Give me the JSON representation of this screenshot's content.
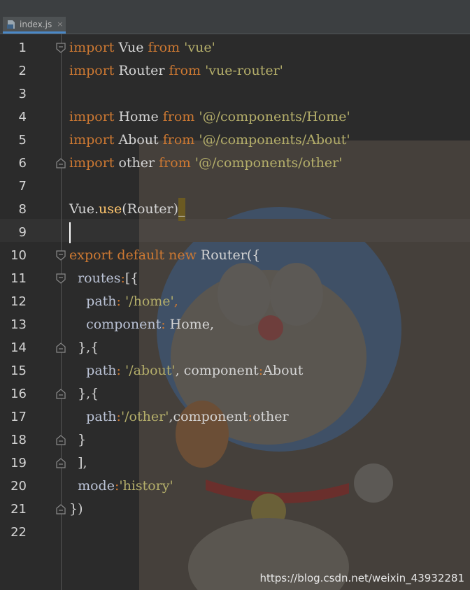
{
  "tab": {
    "label": "index.js",
    "close": "×"
  },
  "lines": [
    {
      "num": "1",
      "tokens": [
        {
          "t": "import",
          "c": "kw"
        },
        {
          "t": " Vue ",
          "c": "txt"
        },
        {
          "t": "from",
          "c": "kw"
        },
        {
          "t": " ",
          "c": "txt"
        },
        {
          "t": "'vue'",
          "c": "str"
        }
      ]
    },
    {
      "num": "2",
      "tokens": [
        {
          "t": "import",
          "c": "kw"
        },
        {
          "t": " Router ",
          "c": "txt"
        },
        {
          "t": "from",
          "c": "kw"
        },
        {
          "t": " ",
          "c": "txt"
        },
        {
          "t": "'vue-router'",
          "c": "str"
        }
      ]
    },
    {
      "num": "3",
      "tokens": []
    },
    {
      "num": "4",
      "tokens": [
        {
          "t": "import",
          "c": "kw"
        },
        {
          "t": " Home ",
          "c": "txt"
        },
        {
          "t": "from",
          "c": "kw"
        },
        {
          "t": " ",
          "c": "txt"
        },
        {
          "t": "'@/components/Home'",
          "c": "str"
        }
      ]
    },
    {
      "num": "5",
      "tokens": [
        {
          "t": "import",
          "c": "kw"
        },
        {
          "t": " About ",
          "c": "txt"
        },
        {
          "t": "from",
          "c": "kw"
        },
        {
          "t": " ",
          "c": "txt"
        },
        {
          "t": "'@/components/About'",
          "c": "str"
        }
      ]
    },
    {
      "num": "6",
      "tokens": [
        {
          "t": "import",
          "c": "kw"
        },
        {
          "t": " other ",
          "c": "txt"
        },
        {
          "t": "from",
          "c": "kw"
        },
        {
          "t": " ",
          "c": "txt"
        },
        {
          "t": "'@/components/other'",
          "c": "str"
        }
      ]
    },
    {
      "num": "7",
      "tokens": []
    },
    {
      "num": "8",
      "tokens": [
        {
          "t": "Vue.",
          "c": "txt"
        },
        {
          "t": "use",
          "c": "call"
        },
        {
          "t": "(Router)",
          "c": "txt"
        },
        {
          "t": "_",
          "c": "match"
        }
      ]
    },
    {
      "num": "9",
      "tokens": [
        {
          "t": "",
          "c": "cursor"
        }
      ]
    },
    {
      "num": "10",
      "tokens": [
        {
          "t": "export",
          "c": "kw"
        },
        {
          "t": " ",
          "c": "txt"
        },
        {
          "t": "default",
          "c": "kw"
        },
        {
          "t": " ",
          "c": "txt"
        },
        {
          "t": "new",
          "c": "kw"
        },
        {
          "t": " Router({",
          "c": "txt"
        }
      ]
    },
    {
      "num": "11",
      "tokens": [
        {
          "t": "  routes",
          "c": "prop"
        },
        {
          "t": ":",
          "c": "kw"
        },
        {
          "t": "[{",
          "c": "txt"
        }
      ]
    },
    {
      "num": "12",
      "tokens": [
        {
          "t": "    path",
          "c": "prop"
        },
        {
          "t": ": ",
          "c": "kw"
        },
        {
          "t": "'/home'",
          "c": "str"
        },
        {
          "t": ",",
          "c": "kw"
        }
      ]
    },
    {
      "num": "13",
      "tokens": [
        {
          "t": "    component",
          "c": "prop"
        },
        {
          "t": ": ",
          "c": "kw"
        },
        {
          "t": "Home,",
          "c": "txt"
        }
      ]
    },
    {
      "num": "14",
      "tokens": [
        {
          "t": "  },{",
          "c": "txt"
        }
      ]
    },
    {
      "num": "15",
      "tokens": [
        {
          "t": "    path",
          "c": "prop"
        },
        {
          "t": ": ",
          "c": "kw"
        },
        {
          "t": "'/about'",
          "c": "str"
        },
        {
          "t": ", component",
          "c": "txt"
        },
        {
          "t": ":",
          "c": "kw"
        },
        {
          "t": "About",
          "c": "txt"
        }
      ]
    },
    {
      "num": "16",
      "tokens": [
        {
          "t": "  },{",
          "c": "txt"
        }
      ]
    },
    {
      "num": "17",
      "tokens": [
        {
          "t": "    path",
          "c": "prop"
        },
        {
          "t": ":",
          "c": "kw"
        },
        {
          "t": "'/other'",
          "c": "str"
        },
        {
          "t": ",component",
          "c": "txt"
        },
        {
          "t": ":",
          "c": "kw"
        },
        {
          "t": "other",
          "c": "txt"
        }
      ]
    },
    {
      "num": "18",
      "tokens": [
        {
          "t": "  }",
          "c": "txt"
        }
      ]
    },
    {
      "num": "19",
      "tokens": [
        {
          "t": "  ],",
          "c": "txt"
        }
      ]
    },
    {
      "num": "20",
      "tokens": [
        {
          "t": "  mode",
          "c": "prop"
        },
        {
          "t": ":",
          "c": "kw"
        },
        {
          "t": "'history'",
          "c": "str"
        }
      ]
    },
    {
      "num": "21",
      "tokens": [
        {
          "t": "})",
          "c": "txt"
        }
      ]
    },
    {
      "num": "22",
      "tokens": []
    }
  ],
  "folds": {
    "1": "open",
    "6": "close",
    "10": "open",
    "11": "open",
    "14": "close",
    "16": "close",
    "18": "close",
    "19": "close",
    "21": "close"
  },
  "watermark": "https://blog.csdn.net/weixin_43932281",
  "colors": {
    "keyword": "#cc7832",
    "string": "#b4ae6a",
    "text": "#d4d4d4",
    "background": "#2b2b2b"
  }
}
